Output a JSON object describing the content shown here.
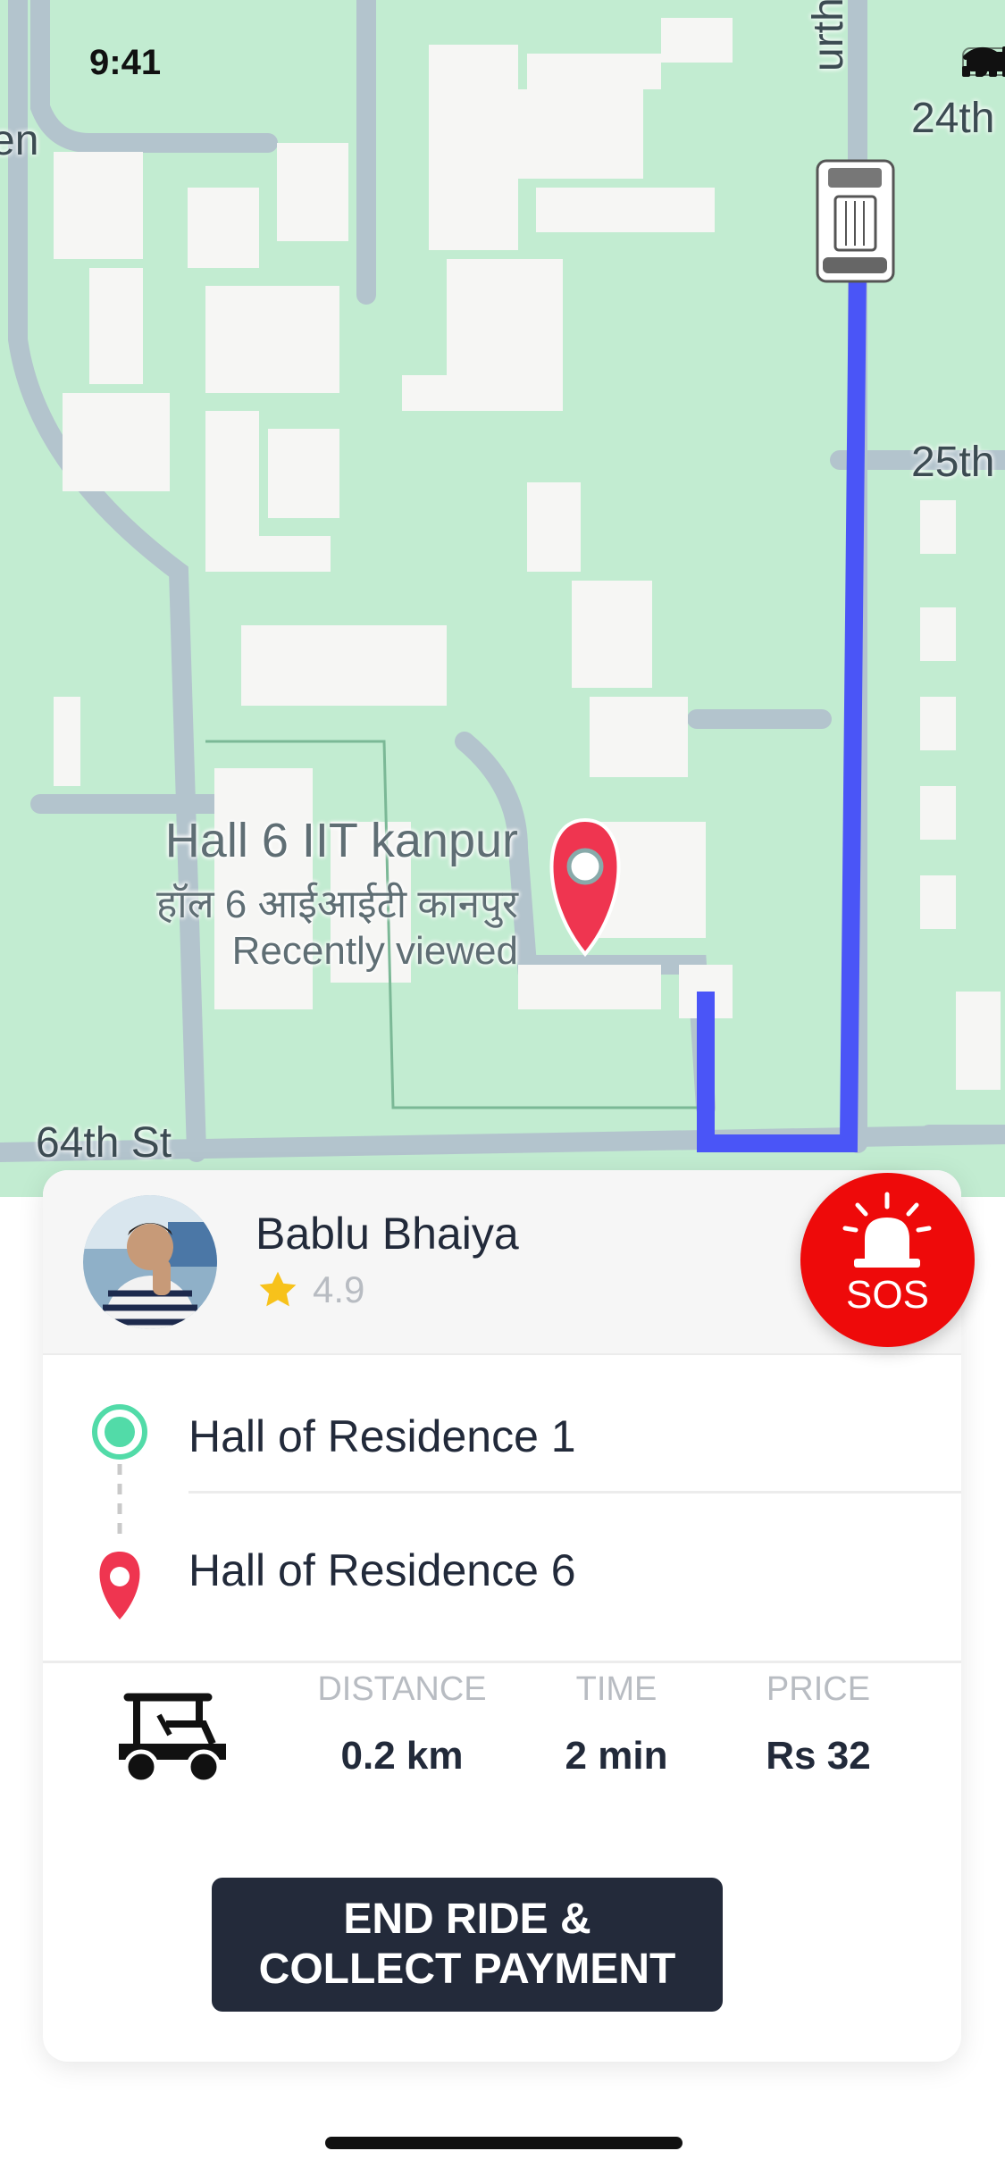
{
  "status_bar": {
    "time": "9:41"
  },
  "map": {
    "place": {
      "name": "Hall 6 IIT kanpur",
      "name_hindi": "हॉल 6 आईआईटी कानपुर",
      "subtitle": "Recently viewed"
    },
    "streets": [
      "64th St",
      "24th",
      "25th",
      "urthAv",
      "en"
    ],
    "pin_icon": "map-pin-icon",
    "vehicle_icon": "golf-cart-top-view-icon",
    "route_color": "#4a55f7"
  },
  "driver": {
    "name": "Bablu Bhaiya",
    "rating": "4.9",
    "star_icon": "star-icon"
  },
  "sos": {
    "label": "SOS",
    "icon": "siren-icon",
    "color": "#ee0a0a"
  },
  "route": {
    "pickup": "Hall of Residence 1",
    "dropoff": "Hall of Residence 6"
  },
  "trip": {
    "vehicle_icon": "golf-cart-icon",
    "distance_label": "DISTANCE",
    "distance_value": "0.2 km",
    "time_label": "TIME",
    "time_value": "2 min",
    "price_label": "PRICE",
    "price_value": "Rs 32"
  },
  "actions": {
    "end_ride": "END RIDE &\nCOLLECT PAYMENT"
  }
}
